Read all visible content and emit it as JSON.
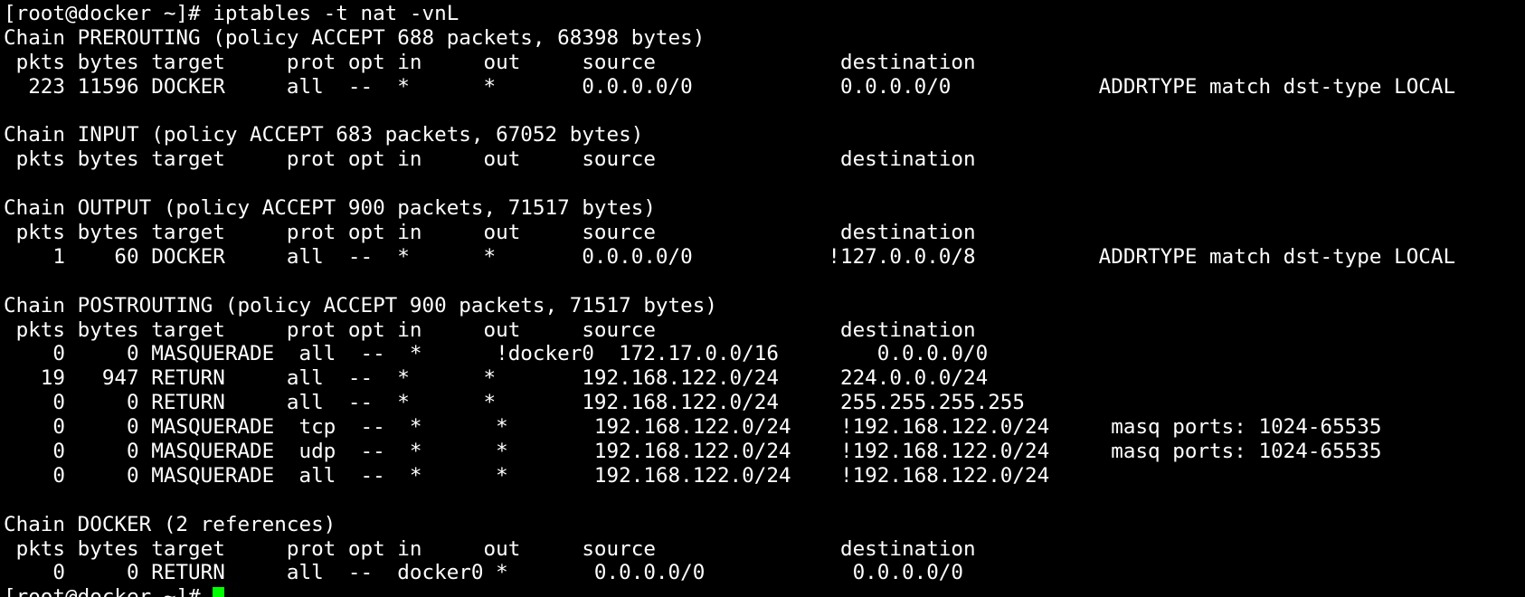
{
  "terminal": {
    "background": "#000000",
    "foreground": "#ffffff",
    "cursor_color": "#00ff00",
    "lines": [
      "[root@docker ~]# iptables -t nat -vnL",
      "Chain PREROUTING (policy ACCEPT 688 packets, 68398 bytes)",
      " pkts bytes target     prot opt in     out     source               destination         ",
      "  223 11596 DOCKER     all  --  *      *       0.0.0.0/0            0.0.0.0/0            ADDRTYPE match dst-type LOCAL",
      "",
      "Chain INPUT (policy ACCEPT 683 packets, 67052 bytes)",
      " pkts bytes target     prot opt in     out     source               destination         ",
      "",
      "Chain OUTPUT (policy ACCEPT 900 packets, 71517 bytes)",
      " pkts bytes target     prot opt in     out     source               destination         ",
      "    1    60 DOCKER     all  --  *      *       0.0.0.0/0           !127.0.0.0/8          ADDRTYPE match dst-type LOCAL",
      "",
      "Chain POSTROUTING (policy ACCEPT 900 packets, 71517 bytes)",
      " pkts bytes target     prot opt in     out     source               destination         ",
      "    0     0 MASQUERADE  all  --  *      !docker0  172.17.0.0/16        0.0.0.0/0           ",
      "   19   947 RETURN     all  --  *      *       192.168.122.0/24     224.0.0.0/24        ",
      "    0     0 RETURN     all  --  *      *       192.168.122.0/24     255.255.255.255     ",
      "    0     0 MASQUERADE  tcp  --  *      *       192.168.122.0/24    !192.168.122.0/24     masq ports: 1024-65535",
      "    0     0 MASQUERADE  udp  --  *      *       192.168.122.0/24    !192.168.122.0/24     masq ports: 1024-65535",
      "    0     0 MASQUERADE  all  --  *      *       192.168.122.0/24    !192.168.122.0/24    ",
      "",
      "Chain DOCKER (2 references)",
      " pkts bytes target     prot opt in     out     source               destination         ",
      "    0     0 RETURN     all  --  docker0 *       0.0.0.0/0            0.0.0.0/0           "
    ],
    "prompt": "[root@docker ~]# "
  }
}
